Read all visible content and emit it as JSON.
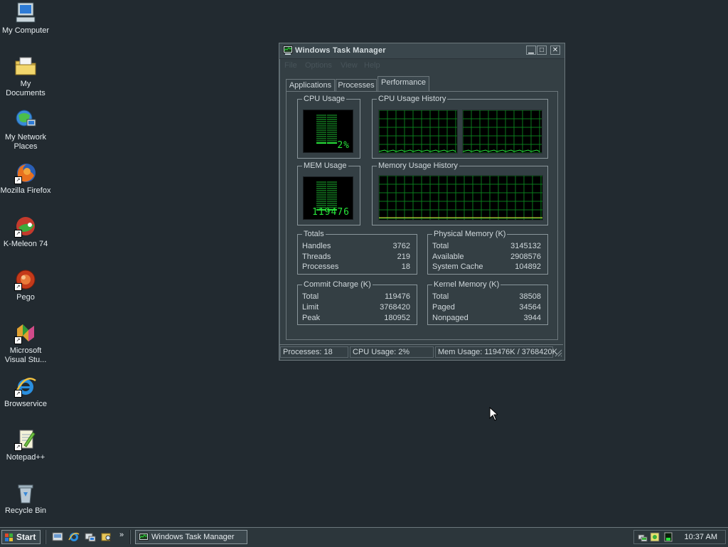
{
  "desktop": {
    "icons": [
      {
        "label": "My Computer"
      },
      {
        "label": "My Documents"
      },
      {
        "label": "My Network Places"
      },
      {
        "label": "Mozilla Firefox"
      },
      {
        "label": "K-Meleon 74"
      },
      {
        "label": "Pego"
      },
      {
        "label": "Microsoft Visual Stu..."
      },
      {
        "label": "Browservice"
      },
      {
        "label": "Notepad++"
      },
      {
        "label": "Recycle Bin"
      }
    ]
  },
  "window": {
    "title": "Windows Task Manager",
    "menu": [
      "File",
      "Options",
      "View",
      "Help"
    ],
    "tabs": [
      {
        "label": "Applications",
        "active": false
      },
      {
        "label": "Processes",
        "active": false
      },
      {
        "label": "Performance",
        "active": true
      }
    ],
    "performance": {
      "cpu_usage": {
        "label": "CPU Usage",
        "value": "2%",
        "percent": 2
      },
      "cpu_history": {
        "label": "CPU Usage History"
      },
      "mem_usage": {
        "label": "MEM Usage",
        "value": "119476"
      },
      "mem_history": {
        "label": "Memory Usage History"
      },
      "totals": {
        "label": "Totals",
        "rows": [
          {
            "key": "Handles",
            "value": "3762"
          },
          {
            "key": "Threads",
            "value": "219"
          },
          {
            "key": "Processes",
            "value": "18"
          }
        ]
      },
      "physical_memory": {
        "label": "Physical Memory (K)",
        "rows": [
          {
            "key": "Total",
            "value": "3145132"
          },
          {
            "key": "Available",
            "value": "2908576"
          },
          {
            "key": "System Cache",
            "value": "104892"
          }
        ]
      },
      "commit_charge": {
        "label": "Commit Charge (K)",
        "rows": [
          {
            "key": "Total",
            "value": "119476"
          },
          {
            "key": "Limit",
            "value": "3768420"
          },
          {
            "key": "Peak",
            "value": "180952"
          }
        ]
      },
      "kernel_memory": {
        "label": "Kernel Memory (K)",
        "rows": [
          {
            "key": "Total",
            "value": "38508"
          },
          {
            "key": "Paged",
            "value": "34564"
          },
          {
            "key": "Nonpaged",
            "value": "3944"
          }
        ]
      }
    },
    "status": {
      "processes": "Processes: 18",
      "cpu": "CPU Usage: 2%",
      "mem": "Mem Usage: 119476K / 3768420K"
    }
  },
  "taskbar": {
    "start_label": "Start",
    "more_glyph": "»",
    "task_button": "Windows Task Manager",
    "clock": "10:37 AM"
  },
  "colors": {
    "desktop": "#222a30",
    "meter_green": "#27e43a",
    "grid_green": "#0a7a1c"
  }
}
